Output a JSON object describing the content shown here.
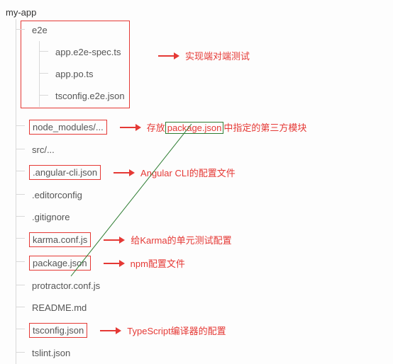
{
  "root": "my-app",
  "e2e": {
    "folder": "e2e",
    "files": [
      "app.e2e-spec.ts",
      "app.po.ts",
      "tsconfig.e2e.json"
    ],
    "annotation": "实现端对端测试"
  },
  "node_modules": {
    "label": "node_modules/...",
    "ann_prefix": "存放",
    "ann_link": "package.json",
    "ann_suffix": "中指定的第三方模块"
  },
  "src": "src/...",
  "angular_cli": {
    "label": ".angular-cli.json",
    "annotation": "Angular CLI的配置文件"
  },
  "editorconfig": ".editorconfig",
  "gitignore": ".gitignore",
  "karma": {
    "label": "karma.conf.js",
    "annotation": "给Karma的单元测试配置"
  },
  "package": {
    "label": "package.json",
    "annotation": "npm配置文件"
  },
  "protractor": "protractor.conf.js",
  "readme": "README.md",
  "tsconfig": {
    "label": "tsconfig.json",
    "annotation": "TypeScript编译器的配置"
  },
  "tslint": "tslint.json"
}
